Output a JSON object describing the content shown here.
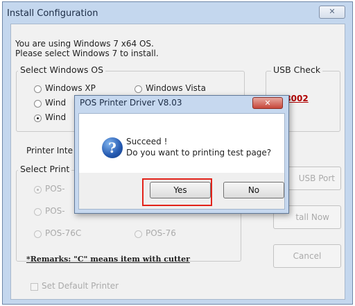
{
  "window": {
    "title": "Install Configuration",
    "close_glyph": "✕",
    "intro_line1": "You are using Windows 7 x64 OS.",
    "intro_line2": "Please select Windows 7 to install."
  },
  "select_os": {
    "legend": "Select Windows OS",
    "options": [
      {
        "label": "Windows XP",
        "selected": false
      },
      {
        "label": "Windows Vista",
        "selected": false
      },
      {
        "label": "Wind",
        "selected": false
      },
      {
        "label": "Wind",
        "selected": true
      }
    ]
  },
  "usb_check": {
    "legend": "USB Check",
    "status": "V8002"
  },
  "printer_interface": {
    "label": "Printer Inte"
  },
  "select_printer": {
    "legend": "Select Print",
    "options": [
      {
        "label": "POS-",
        "selected": true
      },
      {
        "label": "POS-",
        "selected": false
      },
      {
        "label": "POS-76C",
        "selected": false
      },
      {
        "label": "POS-76",
        "selected": false
      }
    ]
  },
  "remarks": "*Remarks: \"C\" means item with cutter",
  "buttons": {
    "usb_port": "USB Port",
    "install_now": "tall Now",
    "cancel": "Cancel"
  },
  "default_printer_label": "Set Default Printer",
  "dialog": {
    "title": "POS Printer Driver V8.03",
    "close_glyph": "✕",
    "icon_glyph": "?",
    "message_line1": "Succeed !",
    "message_line2": "Do you want to printing test page?",
    "yes_label": "Yes",
    "no_label": "No"
  },
  "colors": {
    "highlight": "#e2231a",
    "usb_status": "#b00000"
  }
}
